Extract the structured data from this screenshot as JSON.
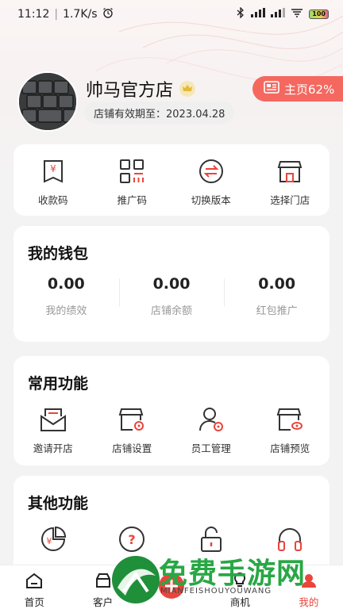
{
  "status_bar": {
    "time": "11:12",
    "net_speed": "1.7K/s",
    "battery": "100"
  },
  "profile": {
    "shop_name": "帅马官方店",
    "expiry": "店铺有效期至：2023.04.28",
    "home_pill": "主页62%"
  },
  "quick_actions": [
    {
      "label": "收款码",
      "icon": "yuan-bookmark-icon"
    },
    {
      "label": "推广码",
      "icon": "qr-code-icon"
    },
    {
      "label": "切换版本",
      "icon": "switch-icon"
    },
    {
      "label": "选择门店",
      "icon": "store-icon"
    }
  ],
  "wallet": {
    "title": "我的钱包",
    "items": [
      {
        "value": "0.00",
        "label": "我的绩效"
      },
      {
        "value": "0.00",
        "label": "店铺余额"
      },
      {
        "value": "0.00",
        "label": "红包推广"
      }
    ]
  },
  "common_functions": {
    "title": "常用功能",
    "items": [
      {
        "label": "邀请开店",
        "icon": "invite-mail-icon"
      },
      {
        "label": "店铺设置",
        "icon": "store-settings-icon"
      },
      {
        "label": "员工管理",
        "icon": "staff-icon"
      },
      {
        "label": "店铺预览",
        "icon": "store-preview-icon"
      }
    ]
  },
  "other_functions": {
    "title": "其他功能",
    "items": [
      {
        "icon": "yuan-chart-icon"
      },
      {
        "icon": "help-icon"
      },
      {
        "icon": "unlock-icon"
      },
      {
        "icon": "headset-icon"
      }
    ]
  },
  "tab_bar": [
    {
      "label": "首页",
      "icon": "home-icon"
    },
    {
      "label": "客户",
      "icon": "customer-icon"
    },
    {
      "label": "",
      "icon": "add-icon"
    },
    {
      "label": "商机",
      "icon": "bulb-icon"
    },
    {
      "label": "我的",
      "icon": "mine-icon"
    }
  ],
  "watermark": {
    "title": "免费手游网",
    "subtitle": "MIANFEISHOUYOUWANG"
  },
  "colors": {
    "accent": "#e8453c",
    "pill": "#f46860",
    "watermark": "#28a745"
  }
}
